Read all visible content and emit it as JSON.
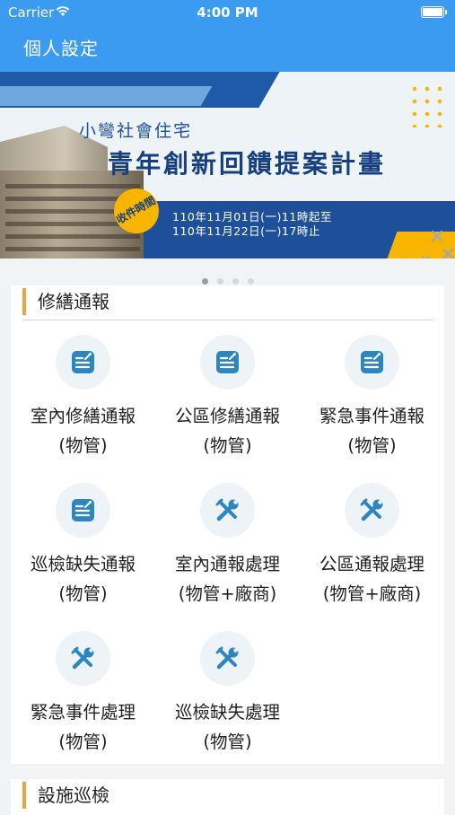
{
  "status_bar": {
    "carrier": "Carrier",
    "time": "4:00 PM"
  },
  "nav": {
    "title": "個人設定"
  },
  "banner": {
    "subtitle": "小彎社會住宅",
    "title": "青年創新回饋提案計畫",
    "badge": "收件時間",
    "date_line1": "110年11月01日(一)11時起至",
    "date_line2": "110年11月22日(一)17時止",
    "page_count": 4,
    "active_page": 1
  },
  "colors": {
    "nav_blue": "#3a9bf0",
    "accent_orange": "#f0a23c",
    "icon_blue": "#2e86c1"
  },
  "sections": [
    {
      "title": "修繕通報",
      "tiles": [
        {
          "line1": "室內修繕通報",
          "line2": "(物管)",
          "icon": "report-icon"
        },
        {
          "line1": "公區修繕通報",
          "line2": "(物管)",
          "icon": "report-icon"
        },
        {
          "line1": "緊急事件通報",
          "line2": "(物管)",
          "icon": "report-icon"
        },
        {
          "line1": "巡檢缺失通報",
          "line2": "(物管)",
          "icon": "report-icon"
        },
        {
          "line1": "室內通報處理",
          "line2": "(物管+廠商)",
          "icon": "tools-icon"
        },
        {
          "line1": "公區通報處理",
          "line2": "(物管+廠商)",
          "icon": "tools-icon"
        },
        {
          "line1": "緊急事件處理",
          "line2": "(物管)",
          "icon": "tools-icon"
        },
        {
          "line1": "巡檢缺失處理",
          "line2": "(物管)",
          "icon": "tools-icon"
        }
      ]
    },
    {
      "title": "設施巡檢"
    }
  ]
}
